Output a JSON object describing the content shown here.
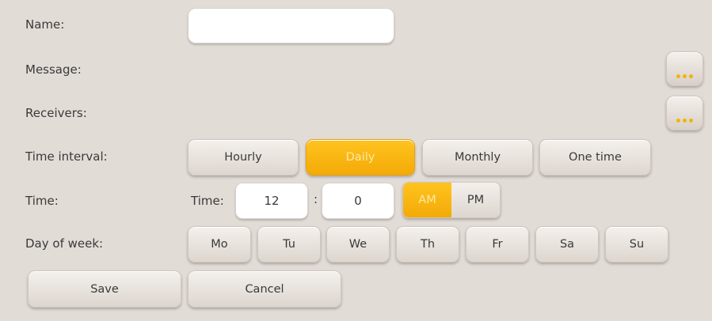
{
  "labels": {
    "name": "Name:",
    "message": "Message:",
    "receivers": "Receivers:",
    "time_interval": "Time interval:",
    "time": "Time:",
    "day_of_week": "Day of week:"
  },
  "name_field": {
    "value": ""
  },
  "message_more_button": {
    "icon": "ellipsis-icon"
  },
  "receivers_more_button": {
    "icon": "ellipsis-icon"
  },
  "time_interval": {
    "options": [
      "Hourly",
      "Daily",
      "Monthly",
      "One time"
    ],
    "selected": "Daily"
  },
  "time_picker": {
    "label": "Time:",
    "hour": "12",
    "separator": ":",
    "minute": "0",
    "am_label": "AM",
    "pm_label": "PM",
    "selected_period": "AM"
  },
  "days": [
    "Mo",
    "Tu",
    "We",
    "Th",
    "Fr",
    "Sa",
    "Su"
  ],
  "actions": {
    "save": "Save",
    "cancel": "Cancel"
  },
  "colors": {
    "accent": "#f7b20f",
    "background": "#e2dcd7"
  }
}
